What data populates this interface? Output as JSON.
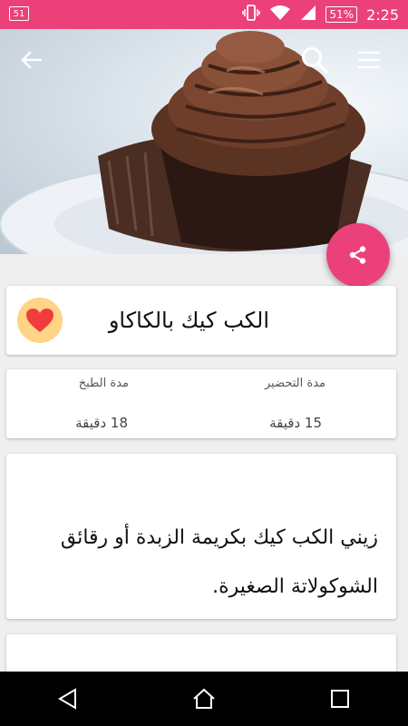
{
  "status_bar": {
    "left_indicator": "51",
    "battery": "51%",
    "time": "2:25"
  },
  "toolbar": {
    "back_icon": "arrow-back-icon",
    "search_icon": "search-icon",
    "menu_icon": "hamburger-menu-icon"
  },
  "hero": {
    "image_alt": "chocolate cupcake with chocolate frosting"
  },
  "share_fab": {
    "icon": "share-icon",
    "color": "#ec407a"
  },
  "recipe": {
    "title": "الكب كيك بالكاكاو",
    "favorite_icon": "heart-icon",
    "favorite_color": "#f03c3c"
  },
  "times": {
    "prep_label": "مدة التحضير",
    "prep_value": "15 دقيقة",
    "cook_label": "مدة الطبخ",
    "cook_value": "18 دقيقة"
  },
  "description": {
    "text": "زيني الكب كيك بكريمة الزبدة أو رقائق الشوكولاتة الصغيرة."
  },
  "nav_bar": {
    "back_icon": "nav-back-icon",
    "home_icon": "nav-home-icon",
    "recents_icon": "nav-recents-icon"
  }
}
